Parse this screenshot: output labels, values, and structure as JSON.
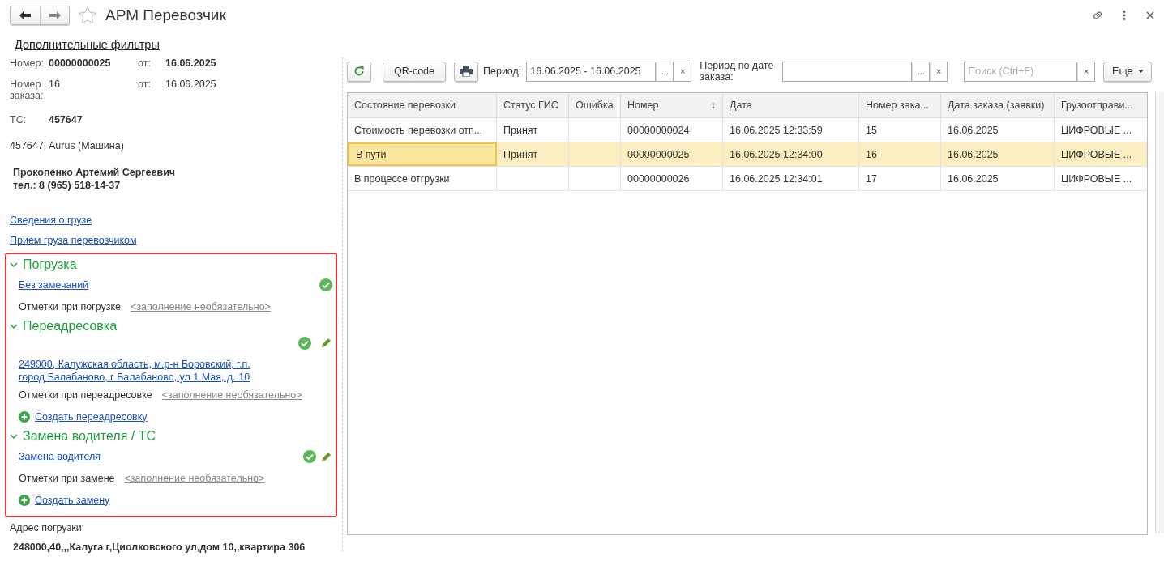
{
  "window": {
    "title": "АРМ Перевозчик",
    "favorite": false
  },
  "filters_link": "Дополнительные фильтры",
  "info": {
    "number_label": "Номер:",
    "number": "00000000025",
    "number_date_label": "от:",
    "number_date": "16.06.2025",
    "order_label": "Номер заказа:",
    "order": "16",
    "order_date_label": "от:",
    "order_date": "16.06.2025",
    "vehicle_label": "ТС:",
    "vehicle": "457647",
    "vehicle_desc": "457647, Aurus (Машина)",
    "driver": "Прокопенко Артемий Сергеевич",
    "phone": "тел.: 8 (965) 518-14-37"
  },
  "links": [
    "Сведения о грузе",
    "Прием груза перевозчиком"
  ],
  "sections": [
    {
      "title": "Погрузка",
      "expanded": true,
      "items": [
        {
          "kind": "link",
          "text": "Без замечаний",
          "ok": true,
          "editable": false
        },
        {
          "kind": "note",
          "label": "Отметки при погрузке",
          "placeholder": "<заполнение необязательно>"
        }
      ]
    },
    {
      "title": "Переадресовка",
      "expanded": true,
      "items": [
        {
          "kind": "address",
          "text": "249000, Калужская область, м.р-н Боровский, г.п. город Балабаново, г Балабаново, ул 1 Мая, д. 10",
          "ok": true,
          "editable": true
        },
        {
          "kind": "note",
          "label": "Отметки при переадресовке",
          "placeholder": "<заполнение необязательно>"
        },
        {
          "kind": "create",
          "text": "Создать переадресовку"
        }
      ]
    },
    {
      "title": "Замена водителя / ТС",
      "expanded": true,
      "items": [
        {
          "kind": "link",
          "text": "Замена водителя",
          "ok": true,
          "editable": true
        },
        {
          "kind": "note",
          "label": "Отметки при замене",
          "placeholder": "<заполнение необязательно>"
        },
        {
          "kind": "create",
          "text": "Создать замену"
        }
      ]
    }
  ],
  "load_address": {
    "label": "Адрес погрузки:",
    "value": "248000,40,,,Калуга г,Циолковского ул,дом 10,,квартира 306"
  },
  "toolbar": {
    "qr": "QR-code",
    "period_label": "Период:",
    "period": "16.06.2025 - 16.06.2025",
    "select": "...",
    "clear": "×",
    "order_period_label": "Период по дате заказа:",
    "search_placeholder": "Поиск (Ctrl+F)",
    "more": "Еще"
  },
  "table": {
    "columns": [
      {
        "label": "Состояние перевозки"
      },
      {
        "label": "Статус ГИС"
      },
      {
        "label": "Ошибка"
      },
      {
        "label": "Номер",
        "sort": "↓"
      },
      {
        "label": "Дата"
      },
      {
        "label": "Номер зака..."
      },
      {
        "label": "Дата заказа (заявки)"
      },
      {
        "label": "Грузоотправи..."
      }
    ],
    "rows": [
      {
        "selected": false,
        "cells": [
          "Стоимость перевозки отп...",
          "Принят",
          "",
          "00000000024",
          "16.06.2025 12:33:59",
          "15",
          "16.06.2025",
          "ЦИФРОВЫЕ ..."
        ]
      },
      {
        "selected": true,
        "cells": [
          "В пути",
          "Принят",
          "",
          "00000000025",
          "16.06.2025 12:34:00",
          "16",
          "16.06.2025",
          "ЦИФРОВЫЕ ..."
        ]
      },
      {
        "selected": false,
        "cells": [
          "В процессе отгрузки",
          "",
          "",
          "00000000026",
          "16.06.2025 12:34:01",
          "17",
          "16.06.2025",
          "ЦИФРОВЫЕ ..."
        ]
      }
    ]
  }
}
